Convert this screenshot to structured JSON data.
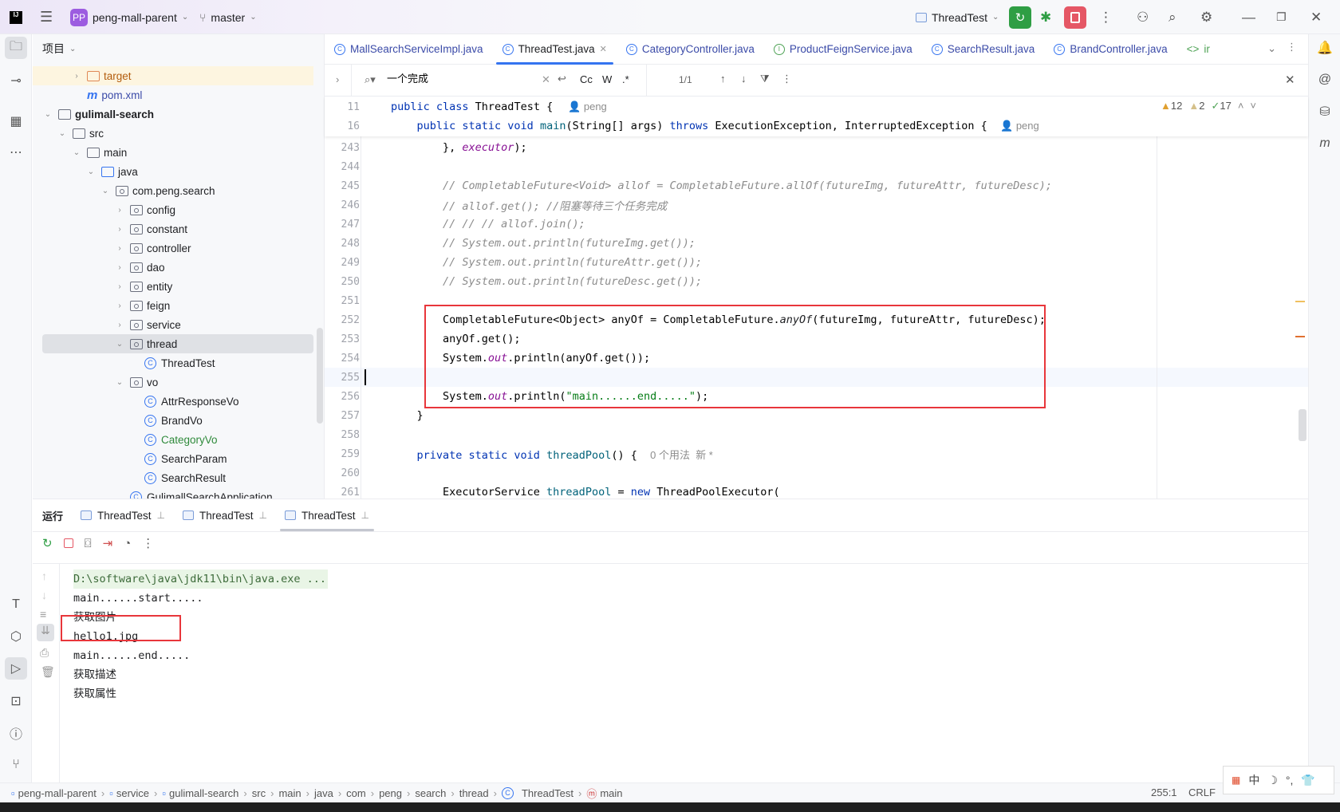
{
  "titlebar": {
    "project_badge": "PP",
    "project": "peng-mall-parent",
    "branch": "master",
    "run_config": "ThreadTest",
    "window_controls": [
      "minimize",
      "restore",
      "close"
    ]
  },
  "project_panel": {
    "title": "项目",
    "tree": [
      {
        "level": 4,
        "label": "target",
        "kind": "folder-orange",
        "arrow": "right",
        "color": "#b35d0e",
        "highlight": true
      },
      {
        "level": 4,
        "label": "pom.xml",
        "kind": "maven",
        "arrow": "",
        "color": "#3b4ba8"
      },
      {
        "level": 2,
        "label": "gulimall-search",
        "kind": "module",
        "arrow": "down",
        "bold": true
      },
      {
        "level": 3,
        "label": "src",
        "kind": "folder",
        "arrow": "down"
      },
      {
        "level": 4,
        "label": "main",
        "kind": "folder",
        "arrow": "down"
      },
      {
        "level": 5,
        "label": "java",
        "kind": "folder-blue",
        "arrow": "down"
      },
      {
        "level": 6,
        "label": "com.peng.search",
        "kind": "package",
        "arrow": "down"
      },
      {
        "level": 7,
        "label": "config",
        "kind": "package",
        "arrow": "right"
      },
      {
        "level": 7,
        "label": "constant",
        "kind": "package",
        "arrow": "right"
      },
      {
        "level": 7,
        "label": "controller",
        "kind": "package",
        "arrow": "right"
      },
      {
        "level": 7,
        "label": "dao",
        "kind": "package",
        "arrow": "right"
      },
      {
        "level": 7,
        "label": "entity",
        "kind": "package",
        "arrow": "right"
      },
      {
        "level": 7,
        "label": "feign",
        "kind": "package",
        "arrow": "right"
      },
      {
        "level": 7,
        "label": "service",
        "kind": "package",
        "arrow": "right"
      },
      {
        "level": 7,
        "label": "thread",
        "kind": "package",
        "arrow": "down",
        "selected": true
      },
      {
        "level": 8,
        "label": "ThreadTest",
        "kind": "class",
        "arrow": ""
      },
      {
        "level": 7,
        "label": "vo",
        "kind": "package",
        "arrow": "down"
      },
      {
        "level": 8,
        "label": "AttrResponseVo",
        "kind": "class",
        "arrow": ""
      },
      {
        "level": 8,
        "label": "BrandVo",
        "kind": "class",
        "arrow": ""
      },
      {
        "level": 8,
        "label": "CategoryVo",
        "kind": "class",
        "arrow": "",
        "color": "#2f8a3b"
      },
      {
        "level": 8,
        "label": "SearchParam",
        "kind": "class",
        "arrow": ""
      },
      {
        "level": 8,
        "label": "SearchResult",
        "kind": "class",
        "arrow": ""
      },
      {
        "level": 7,
        "label": "GulimallSearchApplication",
        "kind": "class",
        "arrow": ""
      }
    ]
  },
  "editor": {
    "tabs": [
      {
        "label": "MallSearchServiceImpl.java",
        "icon": "C"
      },
      {
        "label": "ThreadTest.java",
        "icon": "C",
        "active": true
      },
      {
        "label": "CategoryController.java",
        "icon": "C"
      },
      {
        "label": "ProductFeignService.java",
        "icon": "I"
      },
      {
        "label": "SearchResult.java",
        "icon": "C"
      },
      {
        "label": "BrandController.java",
        "icon": "C"
      },
      {
        "label": "ir",
        "icon": "<>"
      }
    ],
    "find": {
      "query": "一个完成",
      "match_case": "Cc",
      "words": "W",
      "regex": ".*",
      "count": "1/1"
    },
    "inspections": {
      "warnings": "12",
      "weak_warnings": "2",
      "ok": "17"
    },
    "sticky": [
      {
        "no": "11",
        "indent": 0,
        "tokens": [
          [
            "kw",
            "public class "
          ],
          [
            "var",
            "ThreadTest {  "
          ],
          [
            "hint",
            " 👤 peng"
          ]
        ]
      },
      {
        "no": "16",
        "indent": 1,
        "tokens": [
          [
            "kw",
            "public static void "
          ],
          [
            "fn",
            "main"
          ],
          [
            "var",
            "(String[] args) "
          ],
          [
            "kw",
            "throws "
          ],
          [
            "var",
            "ExecutionException, InterruptedException {  "
          ],
          [
            "hint",
            "👤 peng"
          ]
        ]
      }
    ],
    "lines": [
      {
        "no": "243",
        "indent": 2,
        "tokens": [
          [
            "var",
            "}, "
          ],
          [
            "it",
            "executor"
          ],
          [
            "var",
            ");"
          ]
        ]
      },
      {
        "no": "244",
        "indent": 0,
        "tokens": []
      },
      {
        "no": "245",
        "indent": 2,
        "tokens": [
          [
            "cm",
            "// CompletableFuture<Void> allof = CompletableFuture.allOf(futureImg, futureAttr, futureDesc);"
          ]
        ]
      },
      {
        "no": "246",
        "indent": 2,
        "tokens": [
          [
            "cm",
            "// allof.get(); //阻塞等待三个任务完成"
          ]
        ]
      },
      {
        "no": "247",
        "indent": 2,
        "tokens": [
          [
            "cm",
            "// // // allof.join();"
          ]
        ]
      },
      {
        "no": "248",
        "indent": 2,
        "tokens": [
          [
            "cm",
            "// System.out.println(futureImg.get());"
          ]
        ]
      },
      {
        "no": "249",
        "indent": 2,
        "tokens": [
          [
            "cm",
            "// System.out.println(futureAttr.get());"
          ]
        ]
      },
      {
        "no": "250",
        "indent": 2,
        "tokens": [
          [
            "cm",
            "// System.out.println(futureDesc.get());"
          ]
        ]
      },
      {
        "no": "251",
        "indent": 0,
        "tokens": []
      },
      {
        "no": "252",
        "indent": 2,
        "tokens": [
          [
            "var",
            "CompletableFuture<Object> anyOf = CompletableFuture."
          ],
          [
            "st",
            "anyOf"
          ],
          [
            "var",
            "(futureImg, futureAttr, futureDesc);"
          ]
        ]
      },
      {
        "no": "253",
        "indent": 2,
        "tokens": [
          [
            "var",
            "anyOf.get();"
          ]
        ]
      },
      {
        "no": "254",
        "indent": 2,
        "tokens": [
          [
            "var",
            "System."
          ],
          [
            "it",
            "out"
          ],
          [
            "var",
            ".println(anyOf.get());"
          ]
        ]
      },
      {
        "no": "255",
        "indent": 0,
        "tokens": [],
        "current": true
      },
      {
        "no": "256",
        "indent": 2,
        "tokens": [
          [
            "var",
            "System."
          ],
          [
            "it",
            "out"
          ],
          [
            "var",
            ".println("
          ],
          [
            "str",
            "\"main......end.....\""
          ],
          [
            "var",
            ");"
          ]
        ]
      },
      {
        "no": "257",
        "indent": 1,
        "tokens": [
          [
            "var",
            "}"
          ]
        ]
      },
      {
        "no": "258",
        "indent": 0,
        "tokens": []
      },
      {
        "no": "259",
        "indent": 1,
        "tokens": [
          [
            "kw",
            "private static void "
          ],
          [
            "fn",
            "threadPool"
          ],
          [
            "var",
            "() {  "
          ],
          [
            "hint",
            "0 个用法  新 *"
          ]
        ]
      },
      {
        "no": "260",
        "indent": 0,
        "tokens": []
      },
      {
        "no": "261",
        "indent": 2,
        "tokens": [
          [
            "var",
            "ExecutorService "
          ],
          [
            "fn",
            "threadPool"
          ],
          [
            "var",
            " = "
          ],
          [
            "kw",
            "new "
          ],
          [
            "var",
            "ThreadPoolExecutor("
          ]
        ]
      }
    ]
  },
  "run_panel": {
    "title": "运行",
    "tabs": [
      {
        "label": "ThreadTest"
      },
      {
        "label": "ThreadTest"
      },
      {
        "label": "ThreadTest",
        "active": true
      }
    ],
    "output": [
      "D:\\software\\java\\jdk11\\bin\\java.exe ...",
      "main......start.....",
      "获取图片",
      "hello1.jpg",
      "main......end.....",
      "获取描述",
      "获取属性"
    ]
  },
  "statusbar": {
    "breadcrumbs": [
      "peng-mall-parent",
      "service",
      "gulimall-search",
      "src",
      "main",
      "java",
      "com",
      "peng",
      "search",
      "thread",
      "ThreadTest",
      "main"
    ],
    "position": "255:1",
    "line_ending": "CRLF"
  },
  "ime": {
    "mode": "中"
  },
  "colors": {
    "accent": "#3574f0",
    "run_green": "#2f9e44",
    "stop_red": "#e55765",
    "highlight_box": "#e8363b"
  }
}
